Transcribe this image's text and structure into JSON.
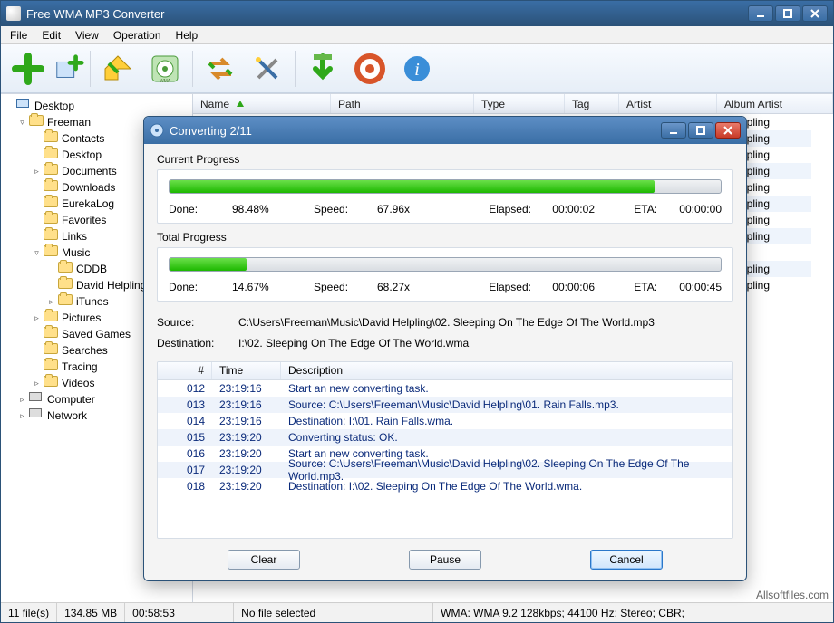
{
  "app": {
    "title": "Free WMA MP3 Converter"
  },
  "menu": [
    "File",
    "Edit",
    "View",
    "Operation",
    "Help"
  ],
  "toolbar_icons": [
    "add",
    "add-folder",
    "convert",
    "disc",
    "import",
    "tools",
    "download",
    "help",
    "info"
  ],
  "tree": [
    {
      "depth": 0,
      "expand": "",
      "kind": "monitor",
      "label": "Desktop"
    },
    {
      "depth": 1,
      "expand": "▿",
      "kind": "folder",
      "label": "Freeman"
    },
    {
      "depth": 2,
      "expand": "",
      "kind": "folder",
      "label": "Contacts"
    },
    {
      "depth": 2,
      "expand": "",
      "kind": "folder",
      "label": "Desktop"
    },
    {
      "depth": 2,
      "expand": "▹",
      "kind": "folder",
      "label": "Documents"
    },
    {
      "depth": 2,
      "expand": "",
      "kind": "folder",
      "label": "Downloads"
    },
    {
      "depth": 2,
      "expand": "",
      "kind": "folder",
      "label": "EurekaLog"
    },
    {
      "depth": 2,
      "expand": "",
      "kind": "folder",
      "label": "Favorites"
    },
    {
      "depth": 2,
      "expand": "",
      "kind": "folder",
      "label": "Links"
    },
    {
      "depth": 2,
      "expand": "▿",
      "kind": "folder",
      "label": "Music"
    },
    {
      "depth": 3,
      "expand": "",
      "kind": "folder",
      "label": "CDDB"
    },
    {
      "depth": 3,
      "expand": "",
      "kind": "folder",
      "label": "David Helpling"
    },
    {
      "depth": 3,
      "expand": "▹",
      "kind": "folder",
      "label": "iTunes"
    },
    {
      "depth": 2,
      "expand": "▹",
      "kind": "folder",
      "label": "Pictures"
    },
    {
      "depth": 2,
      "expand": "",
      "kind": "folder",
      "label": "Saved Games"
    },
    {
      "depth": 2,
      "expand": "",
      "kind": "folder",
      "label": "Searches"
    },
    {
      "depth": 2,
      "expand": "",
      "kind": "folder",
      "label": "Tracing"
    },
    {
      "depth": 2,
      "expand": "▹",
      "kind": "folder",
      "label": "Videos"
    },
    {
      "depth": 1,
      "expand": "▹",
      "kind": "comp",
      "label": "Computer"
    },
    {
      "depth": 1,
      "expand": "▹",
      "kind": "comp",
      "label": "Network"
    }
  ],
  "list_columns": [
    "Name",
    "Path",
    "Type",
    "Tag",
    "Artist",
    "Album Artist"
  ],
  "stub_rows": [
    "id Helpling",
    "id Helpling",
    "id Helpling",
    "id Helpling",
    "id Helpling",
    "id Helpling",
    "id Helpling",
    "id Helpling",
    "",
    "id Helpling",
    "id Helpling"
  ],
  "status": {
    "files": "11 file(s)",
    "size": "134.85 MB",
    "duration": "00:58:53",
    "selection": "No file selected",
    "format": "WMA:  WMA 9.2  128kbps; 44100 Hz; Stereo; CBR;"
  },
  "watermark": "Allsoftfiles.com",
  "dialog": {
    "title": "Converting 2/11",
    "current": {
      "label": "Current Progress",
      "done_lbl": "Done:",
      "done": "98.48%",
      "pct": 88,
      "speed_lbl": "Speed:",
      "speed": "67.96x",
      "elapsed_lbl": "Elapsed:",
      "elapsed": "00:00:02",
      "eta_lbl": "ETA:",
      "eta": "00:00:00"
    },
    "total": {
      "label": "Total Progress",
      "done_lbl": "Done:",
      "done": "14.67%",
      "pct": 14,
      "speed_lbl": "Speed:",
      "speed": "68.27x",
      "elapsed_lbl": "Elapsed:",
      "elapsed": "00:00:06",
      "eta_lbl": "ETA:",
      "eta": "00:00:45"
    },
    "source_lbl": "Source:",
    "source": "C:\\Users\\Freeman\\Music\\David Helpling\\02.  Sleeping On The Edge Of The World.mp3",
    "dest_lbl": "Destination:",
    "dest": "I:\\02.  Sleeping On The Edge Of The World.wma",
    "log_cols": {
      "id": "#",
      "time": "Time",
      "desc": "Description"
    },
    "log": [
      {
        "id": "012",
        "time": "23:19:16",
        "desc": "Start an new converting task."
      },
      {
        "id": "013",
        "time": "23:19:16",
        "desc": "Source:  C:\\Users\\Freeman\\Music\\David Helpling\\01.  Rain Falls.mp3."
      },
      {
        "id": "014",
        "time": "23:19:16",
        "desc": "Destination: I:\\01.  Rain Falls.wma."
      },
      {
        "id": "015",
        "time": "23:19:20",
        "desc": "Converting status: OK."
      },
      {
        "id": "016",
        "time": "23:19:20",
        "desc": "Start an new converting task."
      },
      {
        "id": "017",
        "time": "23:19:20",
        "desc": "Source:  C:\\Users\\Freeman\\Music\\David Helpling\\02.  Sleeping On The Edge Of The World.mp3."
      },
      {
        "id": "018",
        "time": "23:19:20",
        "desc": "Destination: I:\\02.  Sleeping On The Edge Of The World.wma."
      }
    ],
    "buttons": {
      "clear": "Clear",
      "pause": "Pause",
      "cancel": "Cancel"
    }
  }
}
